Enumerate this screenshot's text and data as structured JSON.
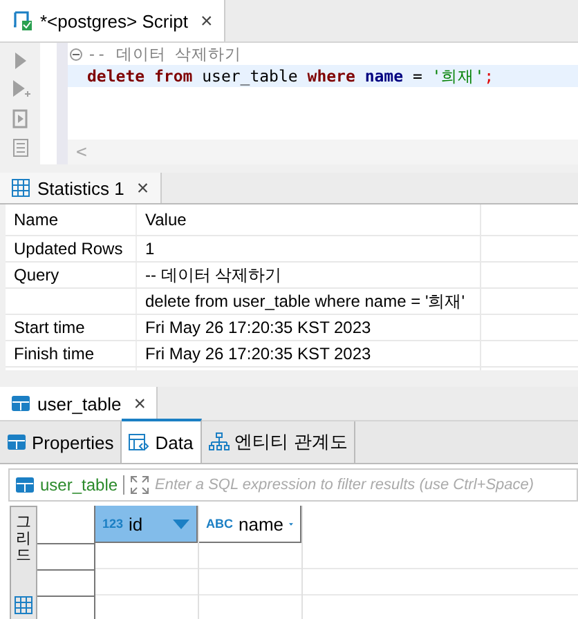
{
  "script_tab": {
    "label": "*<postgres> Script",
    "close": "×",
    "selected": true
  },
  "editor": {
    "lines": [
      [
        {
          "kind": "comment",
          "text": "-- 데이터 삭제하기"
        }
      ],
      [
        {
          "kind": "keyword",
          "text": "delete "
        },
        {
          "kind": "keyword",
          "text": "from"
        },
        {
          "kind": "plain",
          "text": " user_table "
        },
        {
          "kind": "keyword",
          "text": "where "
        },
        {
          "kind": "column",
          "text": "name"
        },
        {
          "kind": "plain",
          "text": " = "
        },
        {
          "kind": "string",
          "text": "'희재'"
        },
        {
          "kind": "punct",
          "text": ";"
        }
      ]
    ],
    "scroll_left": "<"
  },
  "stats_tab": {
    "label": "Statistics 1",
    "close": "×",
    "selected": true
  },
  "stats": {
    "columns": [
      "Name",
      "Value"
    ],
    "rows": [
      {
        "name": "Updated Rows",
        "value": "1"
      },
      {
        "name": "Query",
        "value": "-- 데이터 삭제하기"
      },
      {
        "name": "",
        "value": "delete from user_table where name = '희재'"
      },
      {
        "name": "Start time",
        "value": "Fri May 26 17:20:35 KST 2023"
      },
      {
        "name": "Finish time",
        "value": "Fri May 26 17:20:35 KST 2023"
      }
    ]
  },
  "table_tab": {
    "label": "user_table",
    "close": "×",
    "selected": true
  },
  "sub_tabs": [
    {
      "label": "Properties",
      "kind": "properties",
      "selected": false
    },
    {
      "label": "Data",
      "kind": "data",
      "selected": true
    },
    {
      "label": "엔티티 관계도",
      "kind": "diagram",
      "selected": false
    }
  ],
  "filter": {
    "table": "user_table",
    "placeholder": "Enter a SQL expression to filter results (use Ctrl+Space)"
  },
  "side_tab": "그리드",
  "grid": {
    "columns": [
      {
        "label": "id",
        "type": "123",
        "selected": true
      },
      {
        "label": "name",
        "type": "ABC",
        "selected": false
      }
    ]
  }
}
